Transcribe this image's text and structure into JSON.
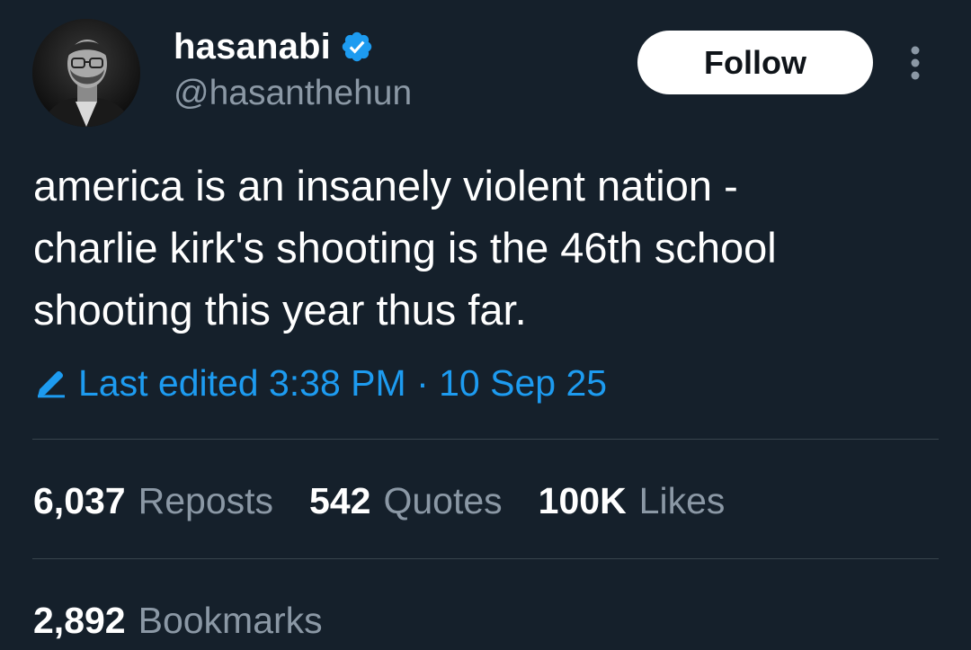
{
  "author": {
    "display_name": "hasanabi",
    "handle": "@hasanthehun",
    "verified_icon": "verified-badge-icon",
    "avatar_icon": "profile-photo"
  },
  "actions": {
    "follow_label": "Follow",
    "more_icon": "more-options-icon"
  },
  "tweet": {
    "text": "america is an insanely violent nation -\ncharlie kirk's shooting is the 46th school\nshooting this year thus far.",
    "edited_label": "Last edited 3:38 PM · 10 Sep 25",
    "edit_icon": "pencil-icon"
  },
  "stats": {
    "reposts_count": "6,037",
    "reposts_label": "Reposts",
    "quotes_count": "542",
    "quotes_label": "Quotes",
    "likes_count": "100K",
    "likes_label": "Likes",
    "bookmarks_count": "2,892",
    "bookmarks_label": "Bookmarks"
  },
  "colors": {
    "background": "#15202b",
    "accent": "#1d9bf0",
    "muted_text": "#8b98a5",
    "divider": "#38444d"
  }
}
